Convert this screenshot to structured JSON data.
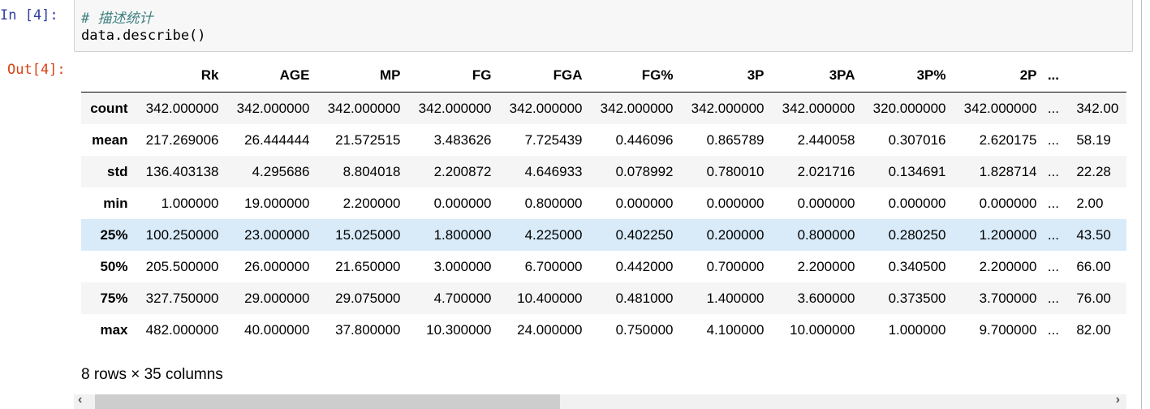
{
  "input_prompt": "In  [4]:",
  "output_prompt": "Out[4]:",
  "code": {
    "line1": "# 描述统计",
    "line2": "data.describe()"
  },
  "table": {
    "columns": [
      "",
      "Rk",
      "AGE",
      "MP",
      "FG",
      "FGA",
      "FG%",
      "3P",
      "3PA",
      "3P%",
      "2P",
      "...",
      ""
    ],
    "rows": [
      {
        "index": "count",
        "values": [
          "342.000000",
          "342.000000",
          "342.000000",
          "342.000000",
          "342.000000",
          "342.000000",
          "342.000000",
          "342.000000",
          "320.000000",
          "342.000000",
          "...",
          "342.00"
        ]
      },
      {
        "index": "mean",
        "values": [
          "217.269006",
          "26.444444",
          "21.572515",
          "3.483626",
          "7.725439",
          "0.446096",
          "0.865789",
          "2.440058",
          "0.307016",
          "2.620175",
          "...",
          "58.19"
        ]
      },
      {
        "index": "std",
        "values": [
          "136.403138",
          "4.295686",
          "8.804018",
          "2.200872",
          "4.646933",
          "0.078992",
          "0.780010",
          "2.021716",
          "0.134691",
          "1.828714",
          "...",
          "22.28"
        ]
      },
      {
        "index": "min",
        "values": [
          "1.000000",
          "19.000000",
          "2.200000",
          "0.000000",
          "0.800000",
          "0.000000",
          "0.000000",
          "0.000000",
          "0.000000",
          "0.000000",
          "...",
          "2.00"
        ]
      },
      {
        "index": "25%",
        "values": [
          "100.250000",
          "23.000000",
          "15.025000",
          "1.800000",
          "4.225000",
          "0.402250",
          "0.200000",
          "0.800000",
          "0.280250",
          "1.200000",
          "...",
          "43.50"
        ]
      },
      {
        "index": "50%",
        "values": [
          "205.500000",
          "26.000000",
          "21.650000",
          "3.000000",
          "6.700000",
          "0.442000",
          "0.700000",
          "2.200000",
          "0.340500",
          "2.200000",
          "...",
          "66.00"
        ]
      },
      {
        "index": "75%",
        "values": [
          "327.750000",
          "29.000000",
          "29.075000",
          "4.700000",
          "10.400000",
          "0.481000",
          "1.400000",
          "3.600000",
          "0.373500",
          "3.700000",
          "...",
          "76.00"
        ]
      },
      {
        "index": "max",
        "values": [
          "482.000000",
          "40.000000",
          "37.800000",
          "10.300000",
          "24.000000",
          "0.750000",
          "4.100000",
          "10.000000",
          "1.000000",
          "9.700000",
          "...",
          "82.00"
        ]
      }
    ],
    "hover_row": "25%",
    "hover_color": "#d9ebf9",
    "stripe_color": "#f5f5f5"
  },
  "shape_text": "8 rows × 35 columns",
  "scrollbar": {
    "left_arrow": "‹",
    "right_arrow": "›",
    "position_fraction": 0.0,
    "visible_fraction": 0.46
  }
}
